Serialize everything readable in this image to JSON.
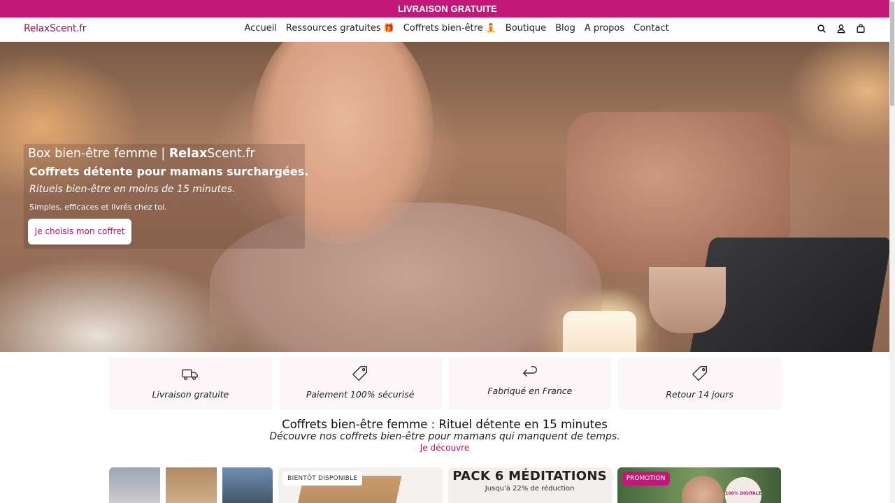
{
  "announcement": "LIVRAISON GRATUITE",
  "header": {
    "logo": "RelaxScent.fr",
    "nav": [
      {
        "label": "Accueil"
      },
      {
        "label": "Ressources gratuites",
        "emoji": "🎁"
      },
      {
        "label": "Coffrets bien-être",
        "emoji": "🧘"
      },
      {
        "label": "Boutique"
      },
      {
        "label": "Blog"
      },
      {
        "label": "A propos"
      },
      {
        "label": "Contact"
      }
    ],
    "icons": [
      "search-icon",
      "account-icon",
      "cart-icon"
    ]
  },
  "hero": {
    "title_prefix": "Box bien-être femme | ",
    "title_brand_bold": "Relax",
    "title_brand_rest": "Scent.fr",
    "subtitle": "Coffrets détente pour mamans surchargées.",
    "italic_line": "Rituels bien-être en moins de 15 minutes.",
    "small_line": "Simples, efficaces et livrés chez toi.",
    "cta": "Je choisis mon coffret"
  },
  "features": [
    {
      "icon": "truck-icon",
      "label": "Livraison gratuite"
    },
    {
      "icon": "tag-icon",
      "label": "Paiement 100% sécurisé"
    },
    {
      "icon": "return-arrow-icon",
      "label": "Fabriqué en France"
    },
    {
      "icon": "tag-icon",
      "label": "Retour 14 jours"
    }
  ],
  "section": {
    "title": "Coffrets bien-être femme : Rituel détente en 15 minutes",
    "subtitle": "Découvre nos coffrets bien-être pour mamans qui manquent de temps.",
    "link": "Je découvre"
  },
  "cards": {
    "soon_badge": "BIENTÔT DISPONIBLE",
    "pack_title": "PACK 6 MÉDITATIONS",
    "pack_sub": "Jusqu'à 22% de réduction",
    "promo_badge": "PROMOTION",
    "seal_text": "100% DIGITALE"
  },
  "colors": {
    "brand": "#c2187a",
    "logo": "#8e1a58",
    "link": "#b5176f"
  }
}
